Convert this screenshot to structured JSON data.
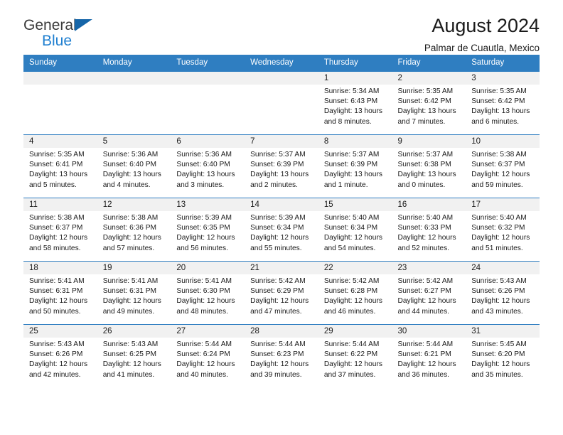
{
  "brand": {
    "name_top": "General",
    "name_bottom": "Blue",
    "color_dark": "#3b3b3b",
    "color_blue": "#1f7fd0",
    "triangle_color": "#1565a8"
  },
  "header": {
    "title": "August 2024",
    "subtitle": "Palmar de Cuautla, Mexico"
  },
  "theme": {
    "header_row_bg": "#2f7ec1",
    "header_row_text": "#ffffff",
    "daynum_band_bg": "#f1f1f1",
    "cell_bg": "#ffffff",
    "grid_line": "#2f7ec1"
  },
  "weekday_headers": [
    "Sunday",
    "Monday",
    "Tuesday",
    "Wednesday",
    "Thursday",
    "Friday",
    "Saturday"
  ],
  "labels": {
    "sunrise_prefix": "Sunrise:",
    "sunset_prefix": "Sunset:",
    "daylight_prefix": "Daylight:"
  },
  "weeks": [
    [
      {
        "empty": true
      },
      {
        "empty": true
      },
      {
        "empty": true
      },
      {
        "empty": true
      },
      {
        "empty": false,
        "day": "1",
        "sunrise": "Sunrise: 5:34 AM",
        "sunset": "Sunset: 6:43 PM",
        "daylight": "Daylight: 13 hours and 8 minutes."
      },
      {
        "empty": false,
        "day": "2",
        "sunrise": "Sunrise: 5:35 AM",
        "sunset": "Sunset: 6:42 PM",
        "daylight": "Daylight: 13 hours and 7 minutes."
      },
      {
        "empty": false,
        "day": "3",
        "sunrise": "Sunrise: 5:35 AM",
        "sunset": "Sunset: 6:42 PM",
        "daylight": "Daylight: 13 hours and 6 minutes."
      }
    ],
    [
      {
        "empty": false,
        "day": "4",
        "sunrise": "Sunrise: 5:35 AM",
        "sunset": "Sunset: 6:41 PM",
        "daylight": "Daylight: 13 hours and 5 minutes."
      },
      {
        "empty": false,
        "day": "5",
        "sunrise": "Sunrise: 5:36 AM",
        "sunset": "Sunset: 6:40 PM",
        "daylight": "Daylight: 13 hours and 4 minutes."
      },
      {
        "empty": false,
        "day": "6",
        "sunrise": "Sunrise: 5:36 AM",
        "sunset": "Sunset: 6:40 PM",
        "daylight": "Daylight: 13 hours and 3 minutes."
      },
      {
        "empty": false,
        "day": "7",
        "sunrise": "Sunrise: 5:37 AM",
        "sunset": "Sunset: 6:39 PM",
        "daylight": "Daylight: 13 hours and 2 minutes."
      },
      {
        "empty": false,
        "day": "8",
        "sunrise": "Sunrise: 5:37 AM",
        "sunset": "Sunset: 6:39 PM",
        "daylight": "Daylight: 13 hours and 1 minute."
      },
      {
        "empty": false,
        "day": "9",
        "sunrise": "Sunrise: 5:37 AM",
        "sunset": "Sunset: 6:38 PM",
        "daylight": "Daylight: 13 hours and 0 minutes."
      },
      {
        "empty": false,
        "day": "10",
        "sunrise": "Sunrise: 5:38 AM",
        "sunset": "Sunset: 6:37 PM",
        "daylight": "Daylight: 12 hours and 59 minutes."
      }
    ],
    [
      {
        "empty": false,
        "day": "11",
        "sunrise": "Sunrise: 5:38 AM",
        "sunset": "Sunset: 6:37 PM",
        "daylight": "Daylight: 12 hours and 58 minutes."
      },
      {
        "empty": false,
        "day": "12",
        "sunrise": "Sunrise: 5:38 AM",
        "sunset": "Sunset: 6:36 PM",
        "daylight": "Daylight: 12 hours and 57 minutes."
      },
      {
        "empty": false,
        "day": "13",
        "sunrise": "Sunrise: 5:39 AM",
        "sunset": "Sunset: 6:35 PM",
        "daylight": "Daylight: 12 hours and 56 minutes."
      },
      {
        "empty": false,
        "day": "14",
        "sunrise": "Sunrise: 5:39 AM",
        "sunset": "Sunset: 6:34 PM",
        "daylight": "Daylight: 12 hours and 55 minutes."
      },
      {
        "empty": false,
        "day": "15",
        "sunrise": "Sunrise: 5:40 AM",
        "sunset": "Sunset: 6:34 PM",
        "daylight": "Daylight: 12 hours and 54 minutes."
      },
      {
        "empty": false,
        "day": "16",
        "sunrise": "Sunrise: 5:40 AM",
        "sunset": "Sunset: 6:33 PM",
        "daylight": "Daylight: 12 hours and 52 minutes."
      },
      {
        "empty": false,
        "day": "17",
        "sunrise": "Sunrise: 5:40 AM",
        "sunset": "Sunset: 6:32 PM",
        "daylight": "Daylight: 12 hours and 51 minutes."
      }
    ],
    [
      {
        "empty": false,
        "day": "18",
        "sunrise": "Sunrise: 5:41 AM",
        "sunset": "Sunset: 6:31 PM",
        "daylight": "Daylight: 12 hours and 50 minutes."
      },
      {
        "empty": false,
        "day": "19",
        "sunrise": "Sunrise: 5:41 AM",
        "sunset": "Sunset: 6:31 PM",
        "daylight": "Daylight: 12 hours and 49 minutes."
      },
      {
        "empty": false,
        "day": "20",
        "sunrise": "Sunrise: 5:41 AM",
        "sunset": "Sunset: 6:30 PM",
        "daylight": "Daylight: 12 hours and 48 minutes."
      },
      {
        "empty": false,
        "day": "21",
        "sunrise": "Sunrise: 5:42 AM",
        "sunset": "Sunset: 6:29 PM",
        "daylight": "Daylight: 12 hours and 47 minutes."
      },
      {
        "empty": false,
        "day": "22",
        "sunrise": "Sunrise: 5:42 AM",
        "sunset": "Sunset: 6:28 PM",
        "daylight": "Daylight: 12 hours and 46 minutes."
      },
      {
        "empty": false,
        "day": "23",
        "sunrise": "Sunrise: 5:42 AM",
        "sunset": "Sunset: 6:27 PM",
        "daylight": "Daylight: 12 hours and 44 minutes."
      },
      {
        "empty": false,
        "day": "24",
        "sunrise": "Sunrise: 5:43 AM",
        "sunset": "Sunset: 6:26 PM",
        "daylight": "Daylight: 12 hours and 43 minutes."
      }
    ],
    [
      {
        "empty": false,
        "day": "25",
        "sunrise": "Sunrise: 5:43 AM",
        "sunset": "Sunset: 6:26 PM",
        "daylight": "Daylight: 12 hours and 42 minutes."
      },
      {
        "empty": false,
        "day": "26",
        "sunrise": "Sunrise: 5:43 AM",
        "sunset": "Sunset: 6:25 PM",
        "daylight": "Daylight: 12 hours and 41 minutes."
      },
      {
        "empty": false,
        "day": "27",
        "sunrise": "Sunrise: 5:44 AM",
        "sunset": "Sunset: 6:24 PM",
        "daylight": "Daylight: 12 hours and 40 minutes."
      },
      {
        "empty": false,
        "day": "28",
        "sunrise": "Sunrise: 5:44 AM",
        "sunset": "Sunset: 6:23 PM",
        "daylight": "Daylight: 12 hours and 39 minutes."
      },
      {
        "empty": false,
        "day": "29",
        "sunrise": "Sunrise: 5:44 AM",
        "sunset": "Sunset: 6:22 PM",
        "daylight": "Daylight: 12 hours and 37 minutes."
      },
      {
        "empty": false,
        "day": "30",
        "sunrise": "Sunrise: 5:44 AM",
        "sunset": "Sunset: 6:21 PM",
        "daylight": "Daylight: 12 hours and 36 minutes."
      },
      {
        "empty": false,
        "day": "31",
        "sunrise": "Sunrise: 5:45 AM",
        "sunset": "Sunset: 6:20 PM",
        "daylight": "Daylight: 12 hours and 35 minutes."
      }
    ]
  ]
}
